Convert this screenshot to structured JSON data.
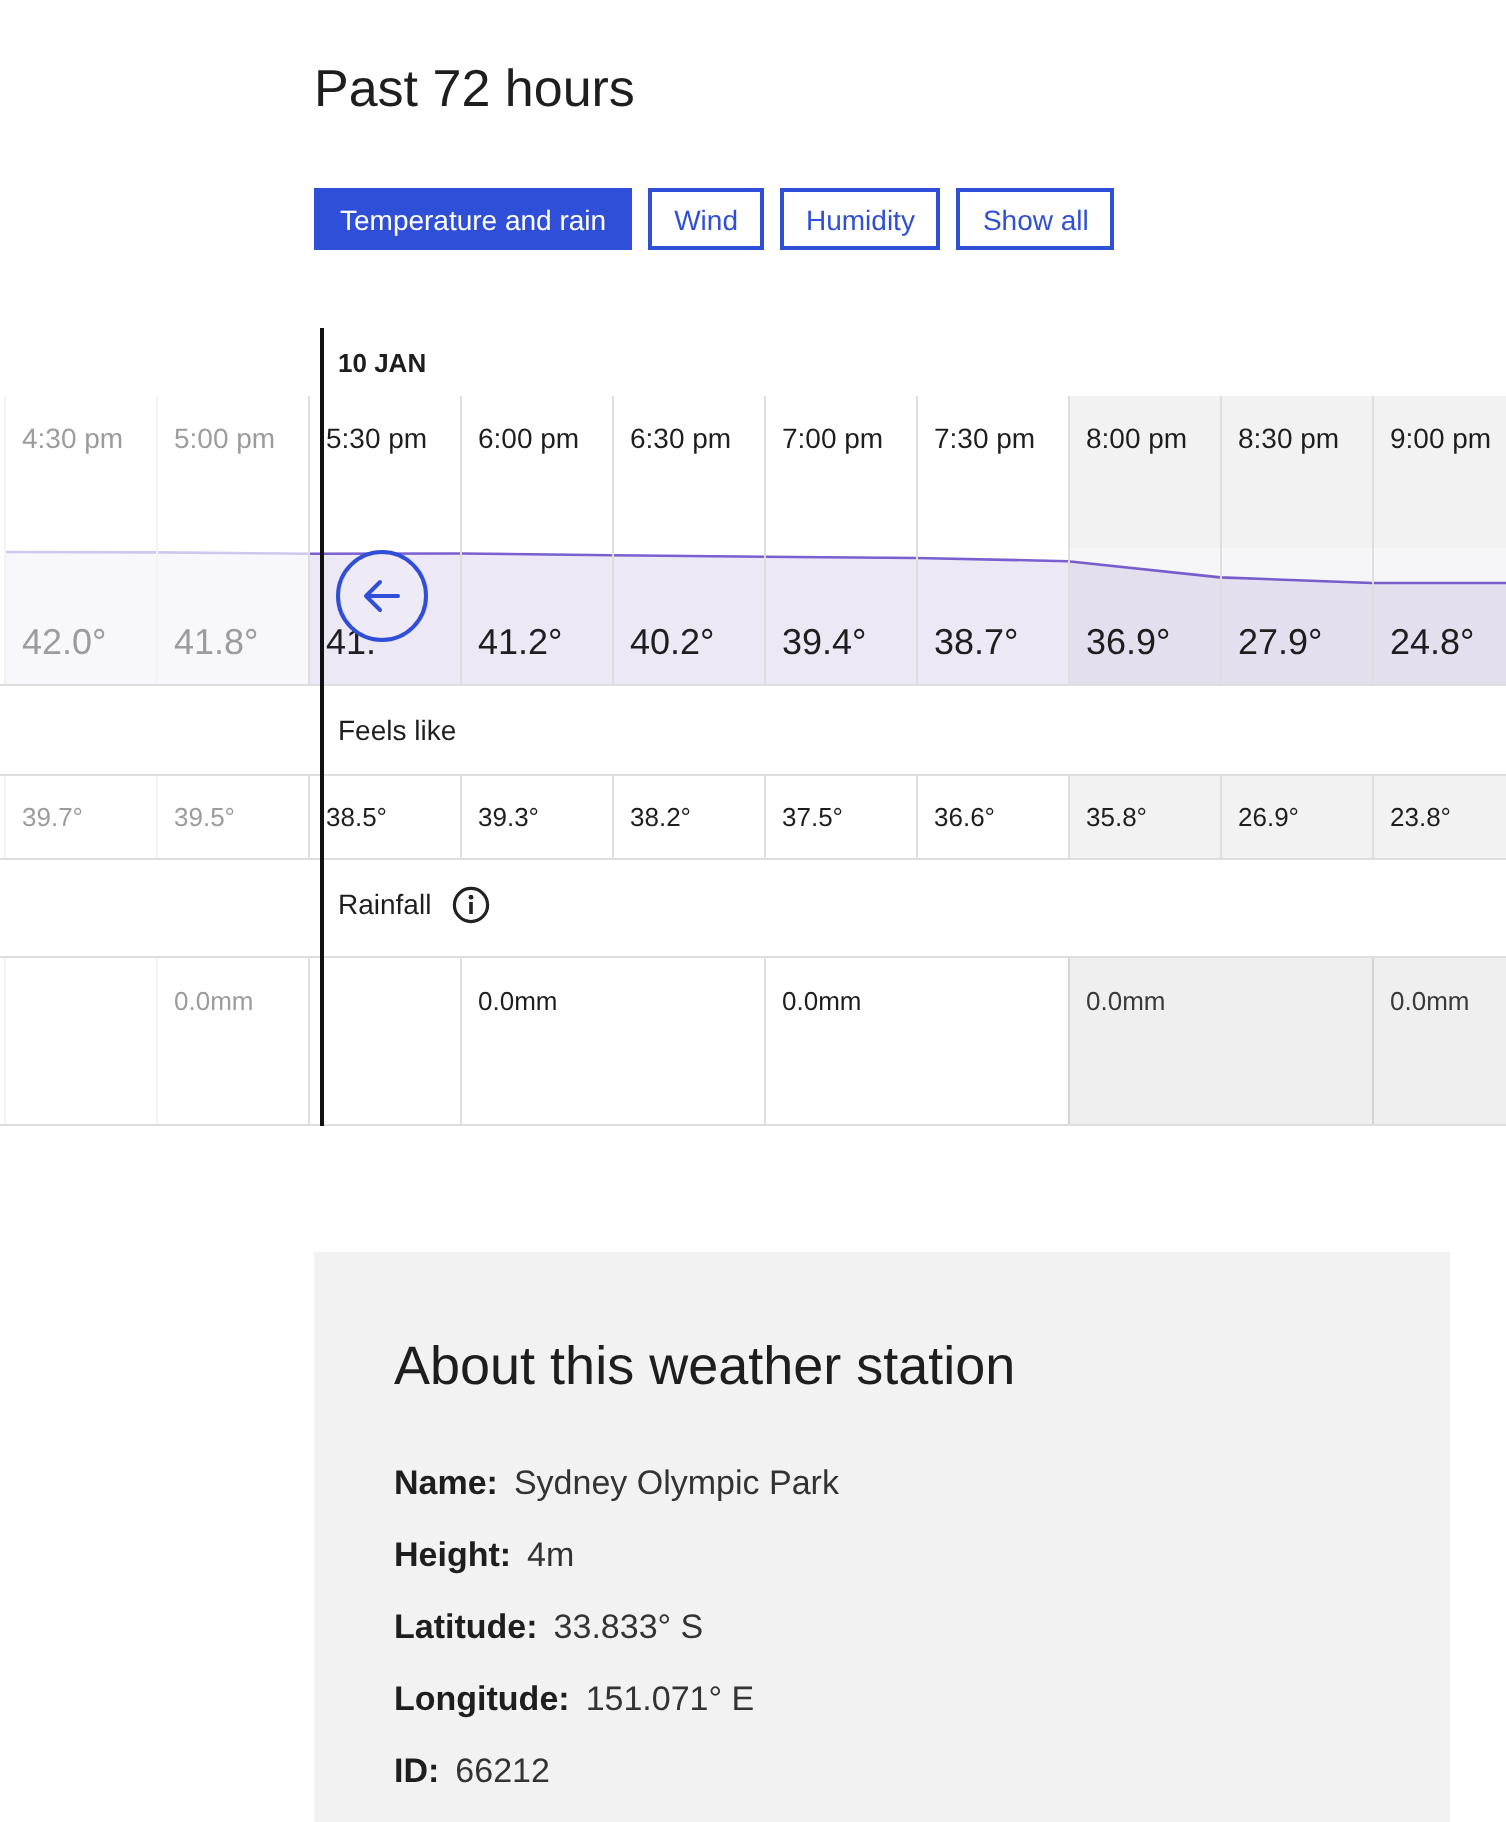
{
  "heading": "Past 72 hours",
  "tabs": [
    {
      "label": "Temperature and rain",
      "selected": true
    },
    {
      "label": "Wind",
      "selected": false
    },
    {
      "label": "Humidity",
      "selected": false
    },
    {
      "label": "Show all",
      "selected": false
    }
  ],
  "date_label": "10 JAN",
  "columns": [
    {
      "time": "4:30 pm",
      "temp": "42.0°",
      "feels": "39.7°",
      "past": true,
      "night": false
    },
    {
      "time": "5:00 pm",
      "temp": "41.8°",
      "feels": "39.5°",
      "past": true,
      "night": false
    },
    {
      "time": "5:30 pm",
      "temp": "41.",
      "feels": "38.5°",
      "past": false,
      "night": false
    },
    {
      "time": "6:00 pm",
      "temp": "41.2°",
      "feels": "39.3°",
      "past": false,
      "night": false
    },
    {
      "time": "6:30 pm",
      "temp": "40.2°",
      "feels": "38.2°",
      "past": false,
      "night": false
    },
    {
      "time": "7:00 pm",
      "temp": "39.4°",
      "feels": "37.5°",
      "past": false,
      "night": false
    },
    {
      "time": "7:30 pm",
      "temp": "38.7°",
      "feels": "36.6°",
      "past": false,
      "night": false
    },
    {
      "time": "8:00 pm",
      "temp": "36.9°",
      "feels": "35.8°",
      "past": false,
      "night": true
    },
    {
      "time": "8:30 pm",
      "temp": "27.9°",
      "feels": "26.9°",
      "past": false,
      "night": true
    },
    {
      "time": "9:00 pm",
      "temp": "24.8°",
      "feels": "23.8°",
      "past": false,
      "night": true
    }
  ],
  "feels_like_label": "Feels like",
  "rainfall_label": "Rainfall",
  "rainfall": [
    {
      "kind": "single",
      "past": true,
      "night": false
    },
    {
      "kind": "single",
      "text": "0.0mm",
      "past": true,
      "night": false
    },
    {
      "kind": "single",
      "past": false,
      "night": false
    },
    {
      "kind": "double",
      "text": "0.0mm",
      "past": false,
      "night": false
    },
    {
      "kind": "double",
      "text": "0.0mm",
      "past": false,
      "night": false
    },
    {
      "kind": "double",
      "text": "0.0mm",
      "past": false,
      "night": true
    },
    {
      "kind": "double",
      "text": "0.0mm",
      "past": false,
      "night": true
    }
  ],
  "station": {
    "title": "About this weather station",
    "details": [
      {
        "label": "Name:",
        "value": "Sydney Olympic Park"
      },
      {
        "label": "Height:",
        "value": "4m"
      },
      {
        "label": "Latitude:",
        "value": "33.833° S"
      },
      {
        "label": "Longitude:",
        "value": "151.071° E"
      },
      {
        "label": "ID:",
        "value": "66212"
      }
    ]
  }
}
